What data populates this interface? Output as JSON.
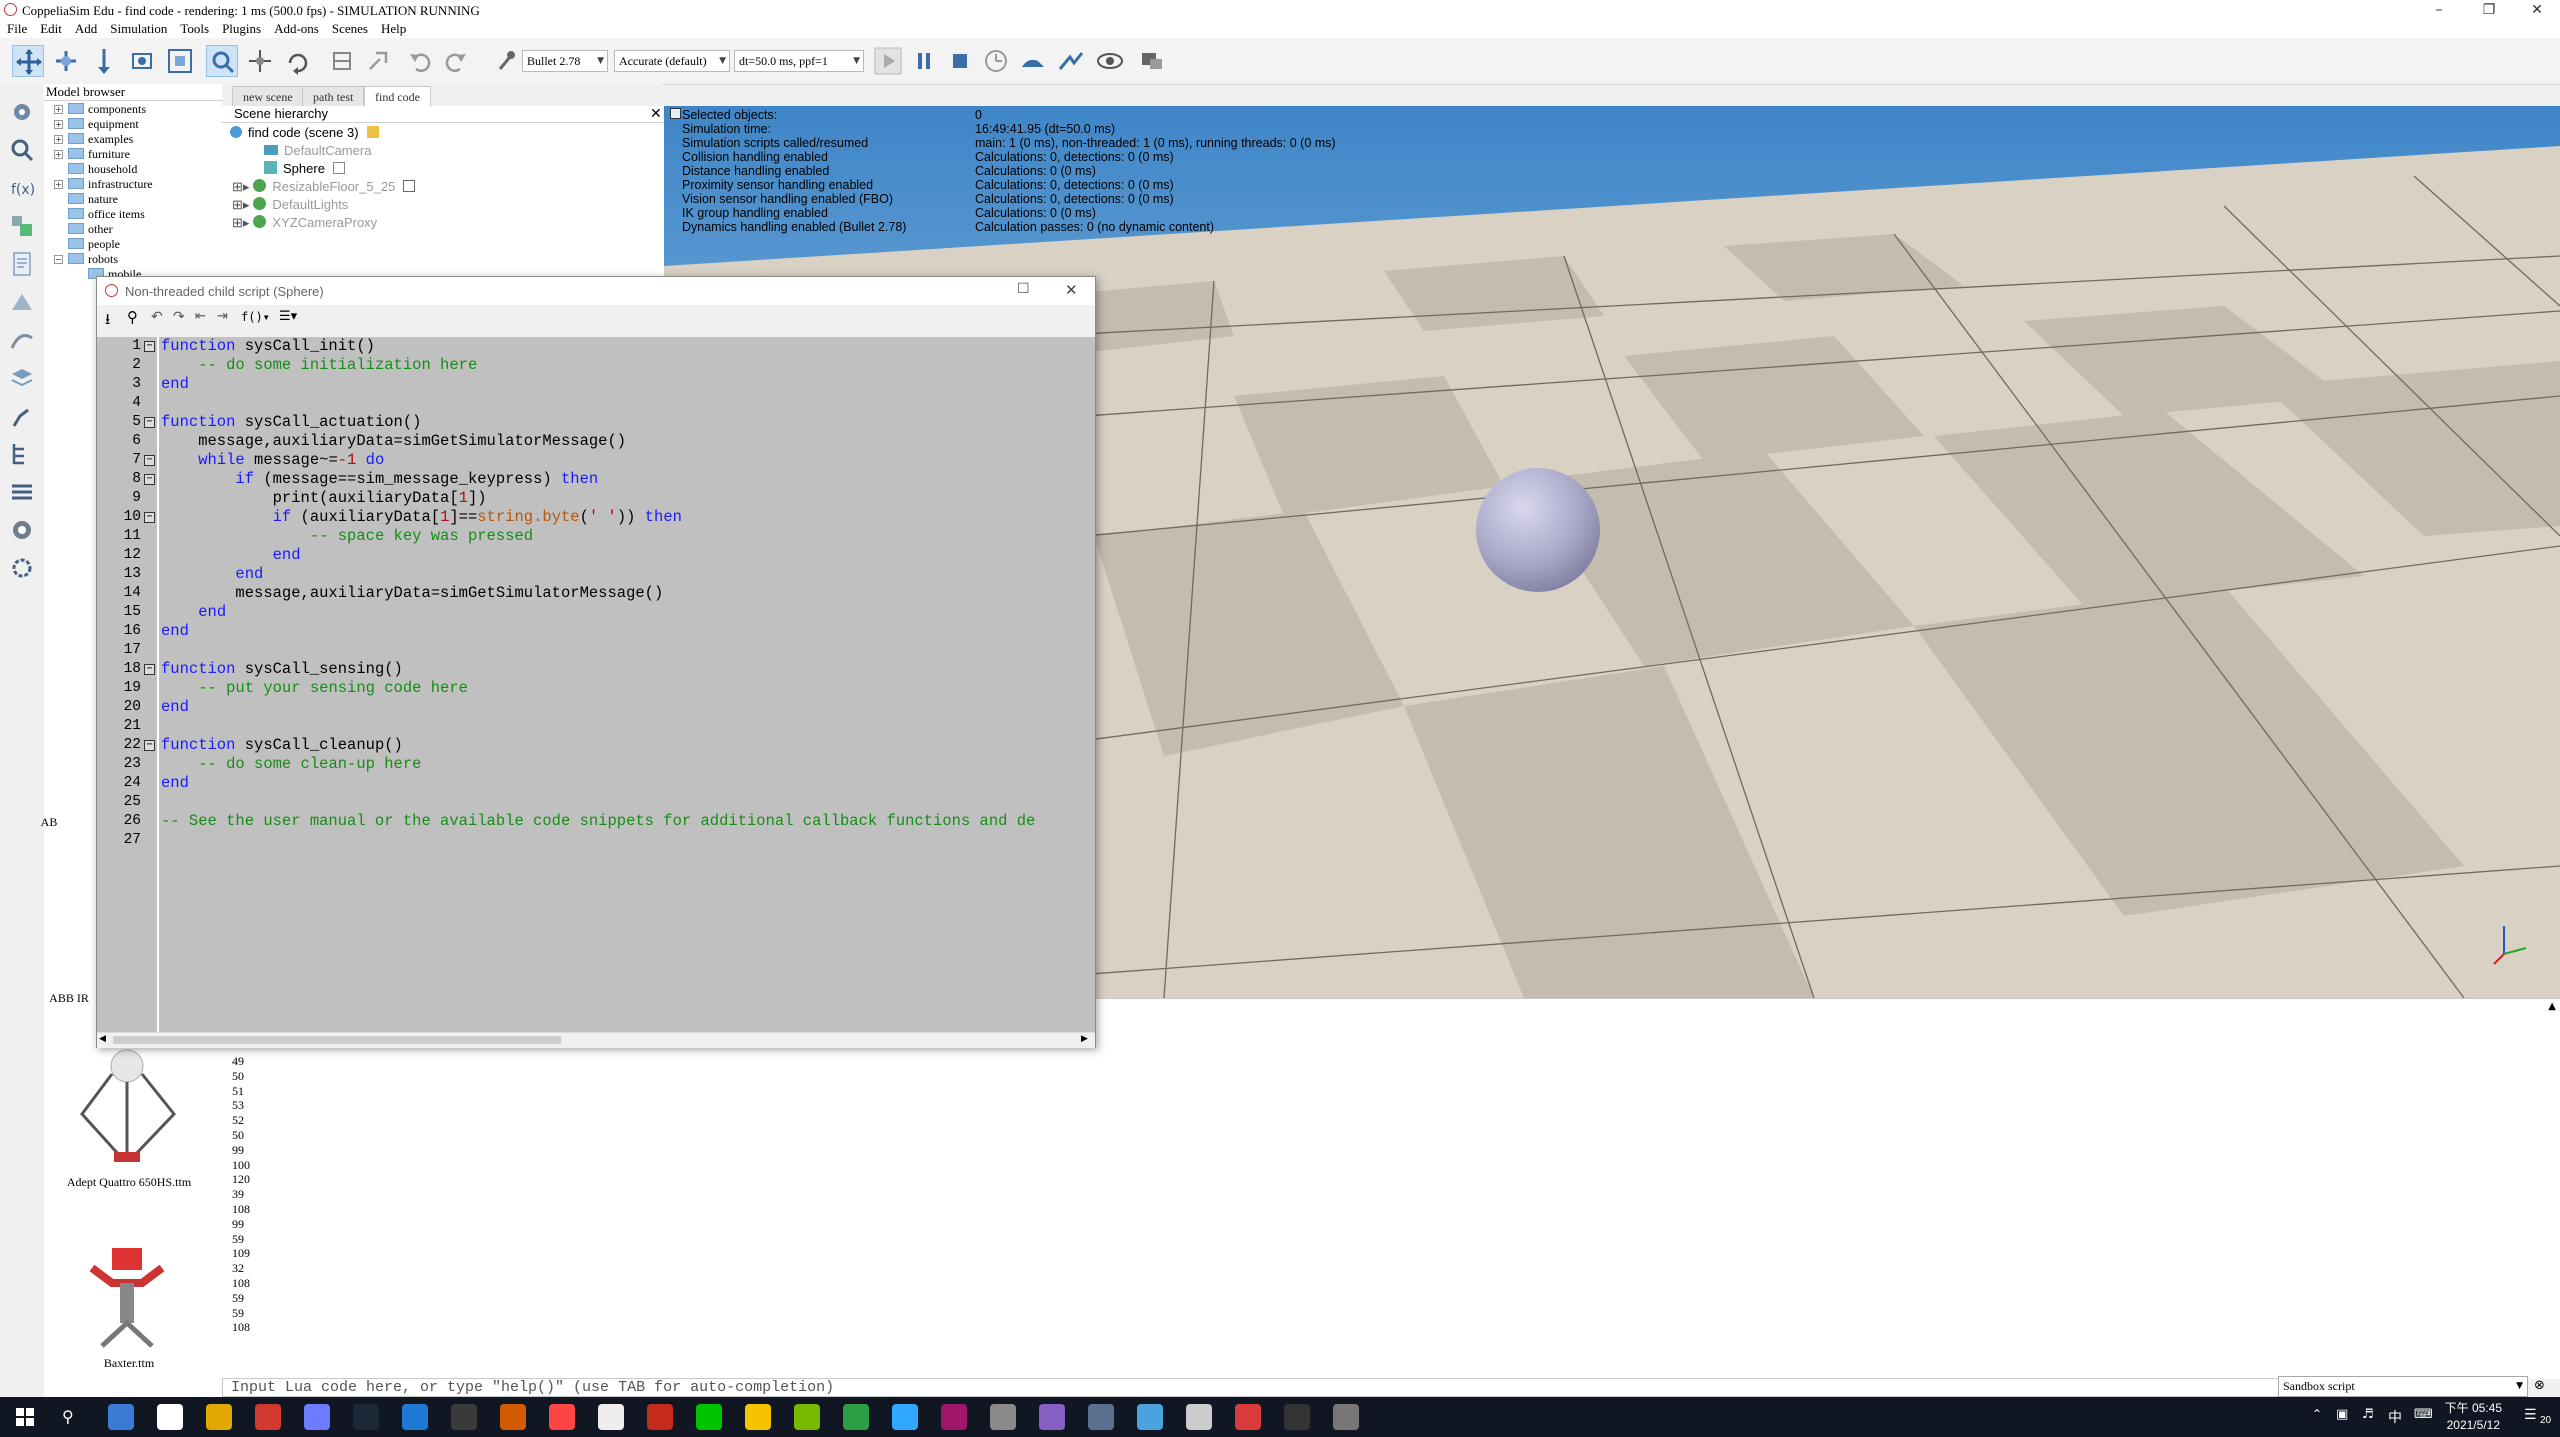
{
  "window": {
    "title": "CoppeliaSim Edu - find code - rendering: 1 ms (500.0 fps) - SIMULATION RUNNING"
  },
  "menu": [
    "File",
    "Edit",
    "Add",
    "Simulation",
    "Tools",
    "Plugins",
    "Add-ons",
    "Scenes",
    "Help"
  ],
  "toolbar": {
    "physics_engine": "Bullet 2.78",
    "accuracy": "Accurate (default)",
    "timestep": "dt=50.0 ms, ppf=1"
  },
  "model_browser": {
    "title": "Model browser",
    "folders": [
      "components",
      "equipment",
      "examples",
      "furniture",
      "household",
      "infrastructure",
      "nature",
      "office items",
      "other",
      "people",
      "robots",
      "mobile"
    ],
    "thumbnails": [
      "ABB IRB...",
      "ABB IR...",
      "Adept Quattro 650HS.ttm",
      "Baxter.ttm"
    ],
    "thumb_stubs": [
      "AB",
      "ABB IR"
    ]
  },
  "tabs": [
    "new scene",
    "path test",
    "find code"
  ],
  "scene_hierarchy": {
    "title": "Scene hierarchy",
    "root": "find code (scene 3)",
    "items": [
      "DefaultCamera",
      "Sphere",
      "ResizableFloor_5_25",
      "DefaultLights",
      "XYZCameraProxy"
    ]
  },
  "info_overlay": {
    "labels": [
      "Selected objects:",
      "Simulation time:",
      "Simulation scripts called/resumed",
      "Collision handling enabled",
      "Distance handling enabled",
      "Proximity sensor handling enabled",
      "Vision sensor handling enabled (FBO)",
      "IK group handling enabled",
      "Dynamics handling enabled (Bullet 2.78)"
    ],
    "values": [
      "0",
      "16:49:41.95 (dt=50.0 ms)",
      "main: 1 (0 ms), non-threaded: 1 (0 ms), running threads: 0 (0 ms)",
      "Calculations: 0, detections: 0 (0 ms)",
      "Calculations: 0 (0 ms)",
      "Calculations: 0, detections: 0 (0 ms)",
      "Calculations: 0, detections: 0 (0 ms)",
      "Calculations: 0 (0 ms)",
      "Calculation passes: 0 (no dynamic content)"
    ]
  },
  "script_editor": {
    "title": "Non-threaded child script (Sphere)",
    "line_numbers": [
      "1",
      "2",
      "3",
      "4",
      "5",
      "6",
      "7",
      "8",
      "9",
      "10",
      "11",
      "12",
      "13",
      "14",
      "15",
      "16",
      "17",
      "18",
      "19",
      "20",
      "21",
      "22",
      "23",
      "24",
      "25",
      "26",
      "27"
    ],
    "lines": [
      "function sysCall_init()",
      "    -- do some initialization here",
      "end",
      "",
      "function sysCall_actuation()",
      "    message,auxiliaryData=simGetSimulatorMessage()",
      "    while message~=-1 do",
      "        if (message==sim_message_keypress) then",
      "            print(auxiliaryData[1])",
      "            if (auxiliaryData[1]==string.byte(' ')) then",
      "                -- space key was pressed",
      "            end",
      "        end",
      "        message,auxiliaryData=simGetSimulatorMessage()",
      "    end",
      "end",
      "",
      "function sysCall_sensing()",
      "    -- put your sensing code here",
      "end",
      "",
      "function sysCall_cleanup()",
      "    -- do some clean-up here",
      "end",
      "",
      "-- See the user manual or the available code snippets for additional callback functions and de",
      ""
    ]
  },
  "console": {
    "lines": [
      "49",
      "50",
      "51",
      "53",
      "52",
      "50",
      "99",
      "100",
      "120",
      "39",
      "108",
      "99",
      "59",
      "109",
      "32",
      "108",
      "59",
      "59",
      "108"
    ],
    "input_placeholder": "Input Lua code here, or type \"help()\" (use TAB for auto-completion)",
    "script_selector": "Sandbox script"
  },
  "taskbar": {
    "time": "下午 05:45",
    "date": "2021/5/12",
    "notify_count": "20",
    "icon_colors": [
      "#3a7bd5",
      "#ffffff",
      "#e0a800",
      "#d13b2f",
      "#6c7cff",
      "#1b2838",
      "#1f7ad6",
      "#3a3a3a",
      "#d45a00",
      "#ff4444",
      "#eeeeee",
      "#c42b1c",
      "#00c300",
      "#f5c400",
      "#76b900",
      "#2e9e44",
      "#31a8ff",
      "#a0166b",
      "#8a8a8a",
      "#865fc5",
      "#5b6f8e",
      "#4aa3df",
      "#cccccc",
      "#d93a3a",
      "#333333",
      "#777777"
    ]
  }
}
